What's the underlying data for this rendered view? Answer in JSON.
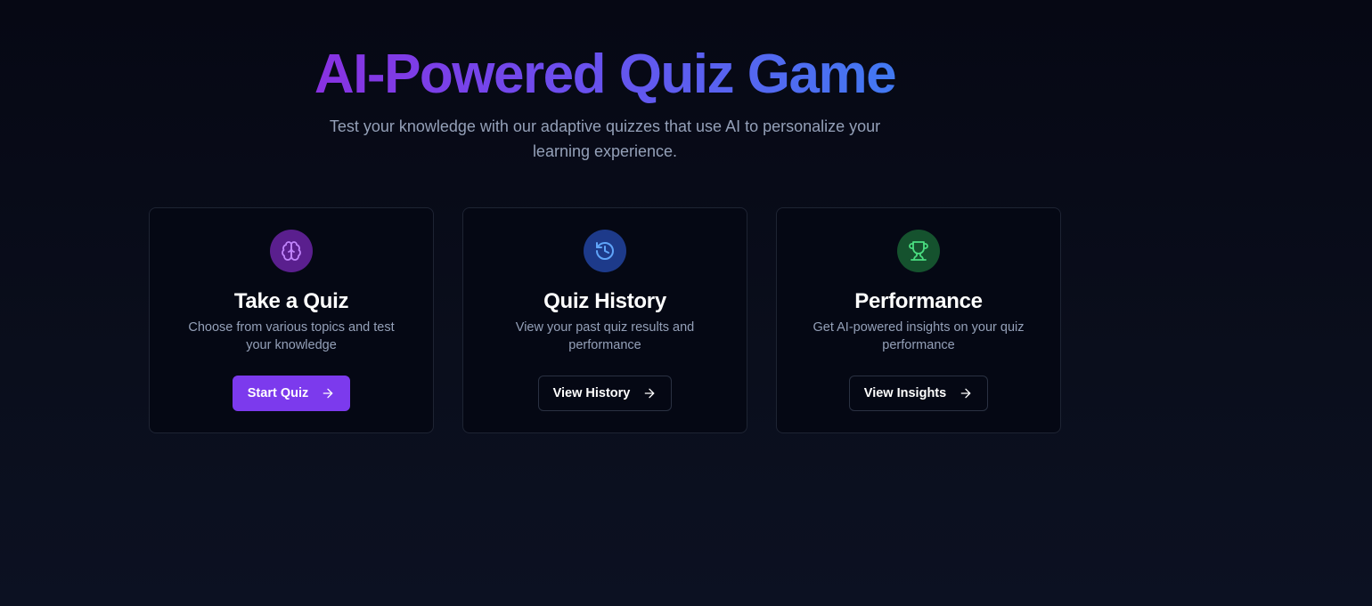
{
  "hero": {
    "title": "AI-Powered Quiz Game",
    "subtitle": "Test your knowledge with our adaptive quizzes that use AI to personalize your learning experience."
  },
  "cards": [
    {
      "icon": "brain-icon",
      "icon_color": "#c084fc",
      "icon_bg": "#5a1f8e",
      "title": "Take a Quiz",
      "description": "Choose from various topics and test your knowledge",
      "button_label": "Start Quiz",
      "button_style": "primary"
    },
    {
      "icon": "history-icon",
      "icon_color": "#60a5fa",
      "icon_bg": "#1d3a8a",
      "title": "Quiz History",
      "description": "View your past quiz results and performance",
      "button_label": "View History",
      "button_style": "outline"
    },
    {
      "icon": "trophy-icon",
      "icon_color": "#4ade80",
      "icon_bg": "#15522e",
      "title": "Performance",
      "description": "Get AI-powered insights on your quiz performance",
      "button_label": "View Insights",
      "button_style": "outline"
    }
  ],
  "colors": {
    "accent": "#7c3aed",
    "background": "#060814",
    "muted_text": "#94a0b8"
  }
}
